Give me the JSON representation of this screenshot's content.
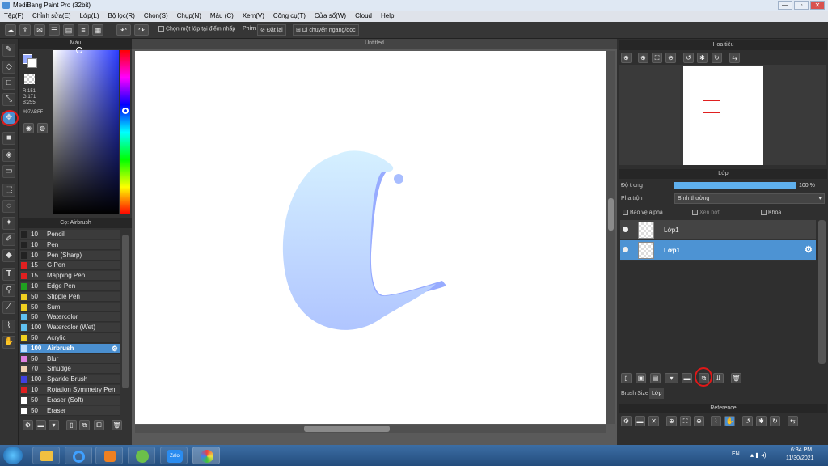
{
  "window": {
    "title": "MediBang Paint Pro (32bit)"
  },
  "menu": [
    "Tệp(F)",
    "Chỉnh sửa(E)",
    "Lớp(L)",
    "Bộ lọc(R)",
    "Chọn(S)",
    "Chụp(N)",
    "Màu (C)",
    "Xem(V)",
    "Công cụ(T)",
    "Cửa sổ(W)",
    "Cloud",
    "Help"
  ],
  "toolbar": {
    "select_one_layer_label": "Chọn một lớp tại điểm nhấp",
    "key_label": "Phím",
    "reset_label": "Đặt lại",
    "move_label": "Di chuyển ngang/dọc"
  },
  "color_panel": {
    "title": "Màu",
    "r": "R:151",
    "g": "G:171",
    "b": "B:255",
    "hex": "#97ABFF",
    "fg_color": "#97abff",
    "bg_color": "#ffffff"
  },
  "brush_panel": {
    "title": "Cọ: Airbrush",
    "brushes": [
      {
        "size": "10",
        "name": "Pencil",
        "color": "#222222"
      },
      {
        "size": "10",
        "name": "Pen",
        "color": "#222222"
      },
      {
        "size": "10",
        "name": "Pen (Sharp)",
        "color": "#222222"
      },
      {
        "size": "15",
        "name": "G Pen",
        "color": "#e02020"
      },
      {
        "size": "15",
        "name": "Mapping Pen",
        "color": "#e02020"
      },
      {
        "size": "10",
        "name": "Edge Pen",
        "color": "#20a020"
      },
      {
        "size": "50",
        "name": "Stipple Pen",
        "color": "#f0d020"
      },
      {
        "size": "50",
        "name": "Sumi",
        "color": "#f0d020"
      },
      {
        "size": "50",
        "name": "Watercolor",
        "color": "#60c0f0"
      },
      {
        "size": "100",
        "name": "Watercolor (Wet)",
        "color": "#60c0f0"
      },
      {
        "size": "50",
        "name": "Acrylic",
        "color": "#f0d020"
      },
      {
        "size": "100",
        "name": "Airbrush",
        "color": "#c0e0ff"
      },
      {
        "size": "50",
        "name": "Blur",
        "color": "#e080e0"
      },
      {
        "size": "70",
        "name": "Smudge",
        "color": "#f0d0b0"
      },
      {
        "size": "100",
        "name": "Sparkle Brush",
        "color": "#4040e0"
      },
      {
        "size": "10",
        "name": "Rotation Symmetry Pen",
        "color": "#e02020"
      },
      {
        "size": "50",
        "name": "Eraser (Soft)",
        "color": "#ffffff"
      },
      {
        "size": "50",
        "name": "Eraser",
        "color": "#ffffff"
      }
    ]
  },
  "canvas": {
    "title": "Untitled"
  },
  "navigator": {
    "title": "Hoa tiêu"
  },
  "layer_panel": {
    "title": "Lớp",
    "opacity_label": "Độ trong",
    "opacity_value": "100 %",
    "opacity_fraction": 1.0,
    "blend_label": "Pha trộn",
    "blend_value": "Bình thường",
    "protect_alpha": "Bảo vệ alpha",
    "clipping": "Xén bớt",
    "lock": "Khóa",
    "layers": [
      {
        "name": "Lớp1",
        "selected": false
      },
      {
        "name": "Lớp1",
        "selected": true
      }
    ],
    "tabs": [
      "Brush Size",
      "Lớp"
    ]
  },
  "reference": {
    "title": "Reference"
  },
  "taskbar": {
    "lang": "EN",
    "time": "6:34 PM",
    "date": "11/30/2021"
  }
}
